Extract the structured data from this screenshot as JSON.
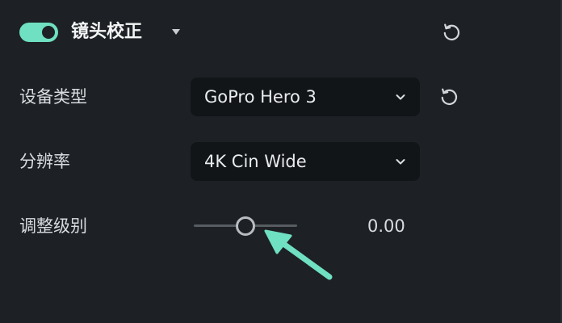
{
  "section": {
    "title": "镜头校正",
    "enabled": true,
    "accent_color": "#6fe0c2"
  },
  "rows": {
    "device_type": {
      "label": "设备类型",
      "value": "GoPro Hero 3"
    },
    "resolution": {
      "label": "分辨率",
      "value": "4K Cin Wide"
    },
    "adjust_level": {
      "label": "调整级别",
      "value": "0.00"
    }
  },
  "icons": {
    "reset": "reset-icon",
    "dropdown": "chevron-down-icon",
    "toggle": "toggle-switch",
    "collapse": "caret-down-icon",
    "pointer": "arrow-annotation"
  }
}
